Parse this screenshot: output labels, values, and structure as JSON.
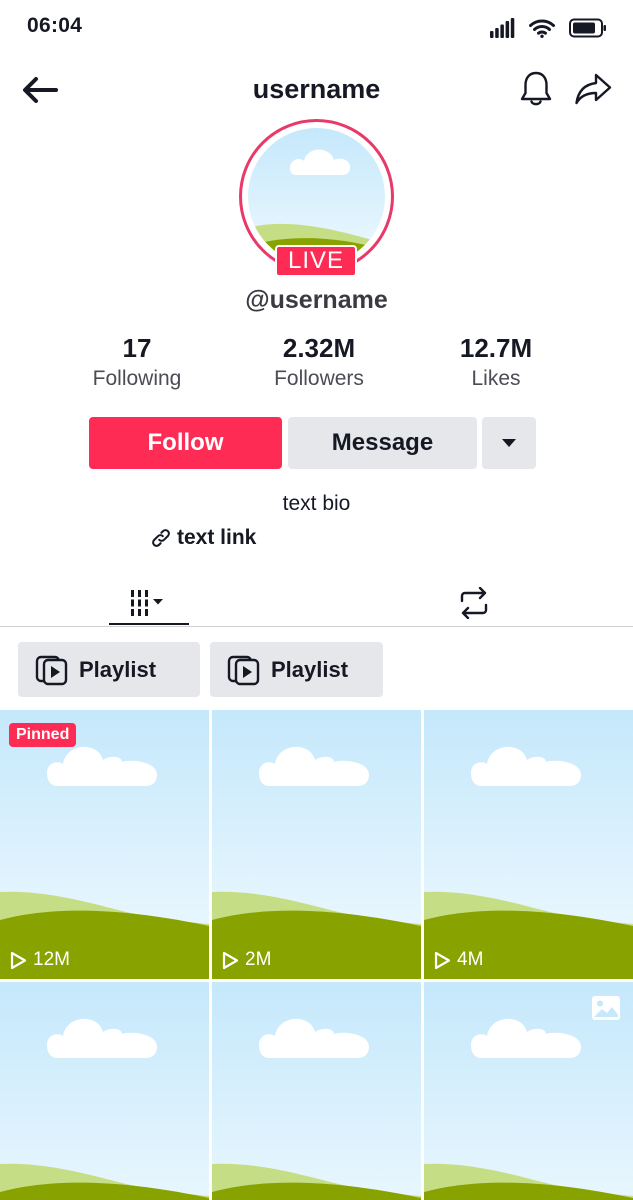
{
  "status_bar": {
    "time": "06:04",
    "icons": [
      "signal-icon",
      "wifi-icon",
      "battery-icon"
    ]
  },
  "nav": {
    "title": "username",
    "icons": [
      "back-arrow-icon",
      "bell-icon",
      "share-icon"
    ]
  },
  "profile": {
    "live_label": "LIVE",
    "handle": "@username",
    "stats": [
      {
        "value": "17",
        "label": "Following"
      },
      {
        "value": "2.32M",
        "label": "Followers"
      },
      {
        "value": "12.7M",
        "label": "Likes"
      }
    ],
    "follow_label": "Follow",
    "message_label": "Message",
    "bio": "text bio",
    "link": "text link"
  },
  "tabs": [
    {
      "icon": "videos-grid-icon",
      "active": true
    },
    {
      "icon": "repost-icon",
      "active": false
    }
  ],
  "playlists": [
    {
      "label": "Playlist"
    },
    {
      "label": "Playlist"
    }
  ],
  "videos": [
    {
      "pinned": "Pinned",
      "views": "12M"
    },
    {
      "views": "2M"
    },
    {
      "views": "4M"
    },
    {},
    {},
    {
      "photo": true
    }
  ],
  "colors": {
    "brand": "#fe2c55",
    "live_ring": "#e8396a",
    "secondary_button": "#e6e7ea",
    "sky": "#c5e8fb",
    "hill_light": "#c5de85",
    "hill_dark": "#88a300"
  }
}
